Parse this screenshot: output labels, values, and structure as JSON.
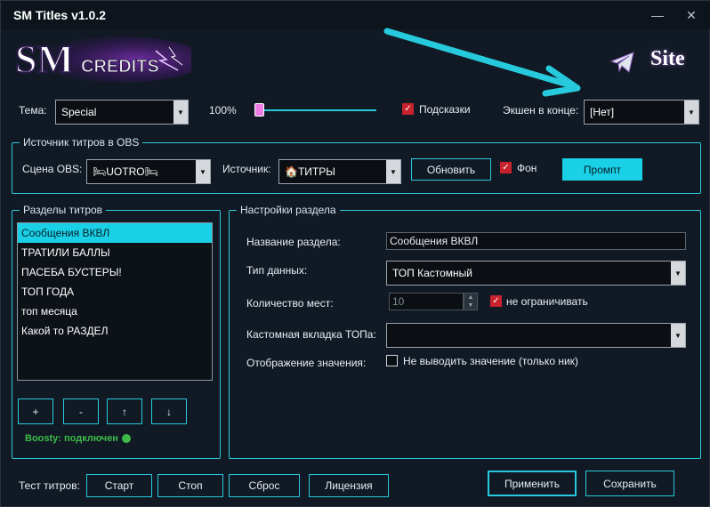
{
  "window": {
    "title": "SM Titles v1.0.2"
  },
  "header": {
    "logo_text": "SM CREDITS",
    "site_label": "Site"
  },
  "top": {
    "theme_label": "Тема:",
    "theme_value": "Special",
    "zoom_value": "100%",
    "zoom_fraction": 0.0,
    "hints_label": "Подсказки",
    "hints_checked": true,
    "end_action_label": "Экшен в конце:",
    "end_action_value": "[Нет]"
  },
  "obs_group": {
    "title": "Источник титров в OBS",
    "scene_label": "Сцена OBS:",
    "scene_value": "🛏UOTRO🛏",
    "source_label": "Источник:",
    "source_value": "🏠ТИТРЫ",
    "refresh_label": "Обновить",
    "bg_label": "Фон",
    "bg_checked": true,
    "prompt_label": "Промпт"
  },
  "sections_group": {
    "title": "Разделы титров",
    "items": [
      "Сообщения ВКВЛ",
      "ТРАТИЛИ БАЛЛЫ",
      "ПАСЕБА БУСТЕРЫ!",
      "ТОП ГОДА",
      "топ месяца",
      "Какой то РАЗДЕЛ"
    ],
    "add_label": "+",
    "remove_label": "-",
    "up_label": "↑",
    "down_label": "↓",
    "boosty_status": "Boosty: подключен"
  },
  "settings_group": {
    "title": "Настройки раздела",
    "name_label": "Название раздела:",
    "name_value": "Сообщения ВКВЛ",
    "type_label": "Тип данных:",
    "type_value": "ТОП Кастомный",
    "count_label": "Количество мест:",
    "count_value": "10",
    "unlimited_label": "не ограничивать",
    "unlimited_checked": true,
    "custom_tab_label": "Кастомная вкладка ТОПа:",
    "custom_tab_value": "",
    "display_label": "Отображение значения:",
    "hide_value_label": "Не выводить значение (только ник)",
    "hide_value_checked": false
  },
  "footer": {
    "test_label": "Тест титров:",
    "start_label": "Старт",
    "stop_label": "Стоп",
    "reset_label": "Сброс",
    "license_label": "Лицензия",
    "apply_label": "Применить",
    "save_label": "Сохранить"
  },
  "colors": {
    "accent": "#1ad0e6",
    "check": "#c8222c",
    "boosty": "#3dbb4a"
  }
}
